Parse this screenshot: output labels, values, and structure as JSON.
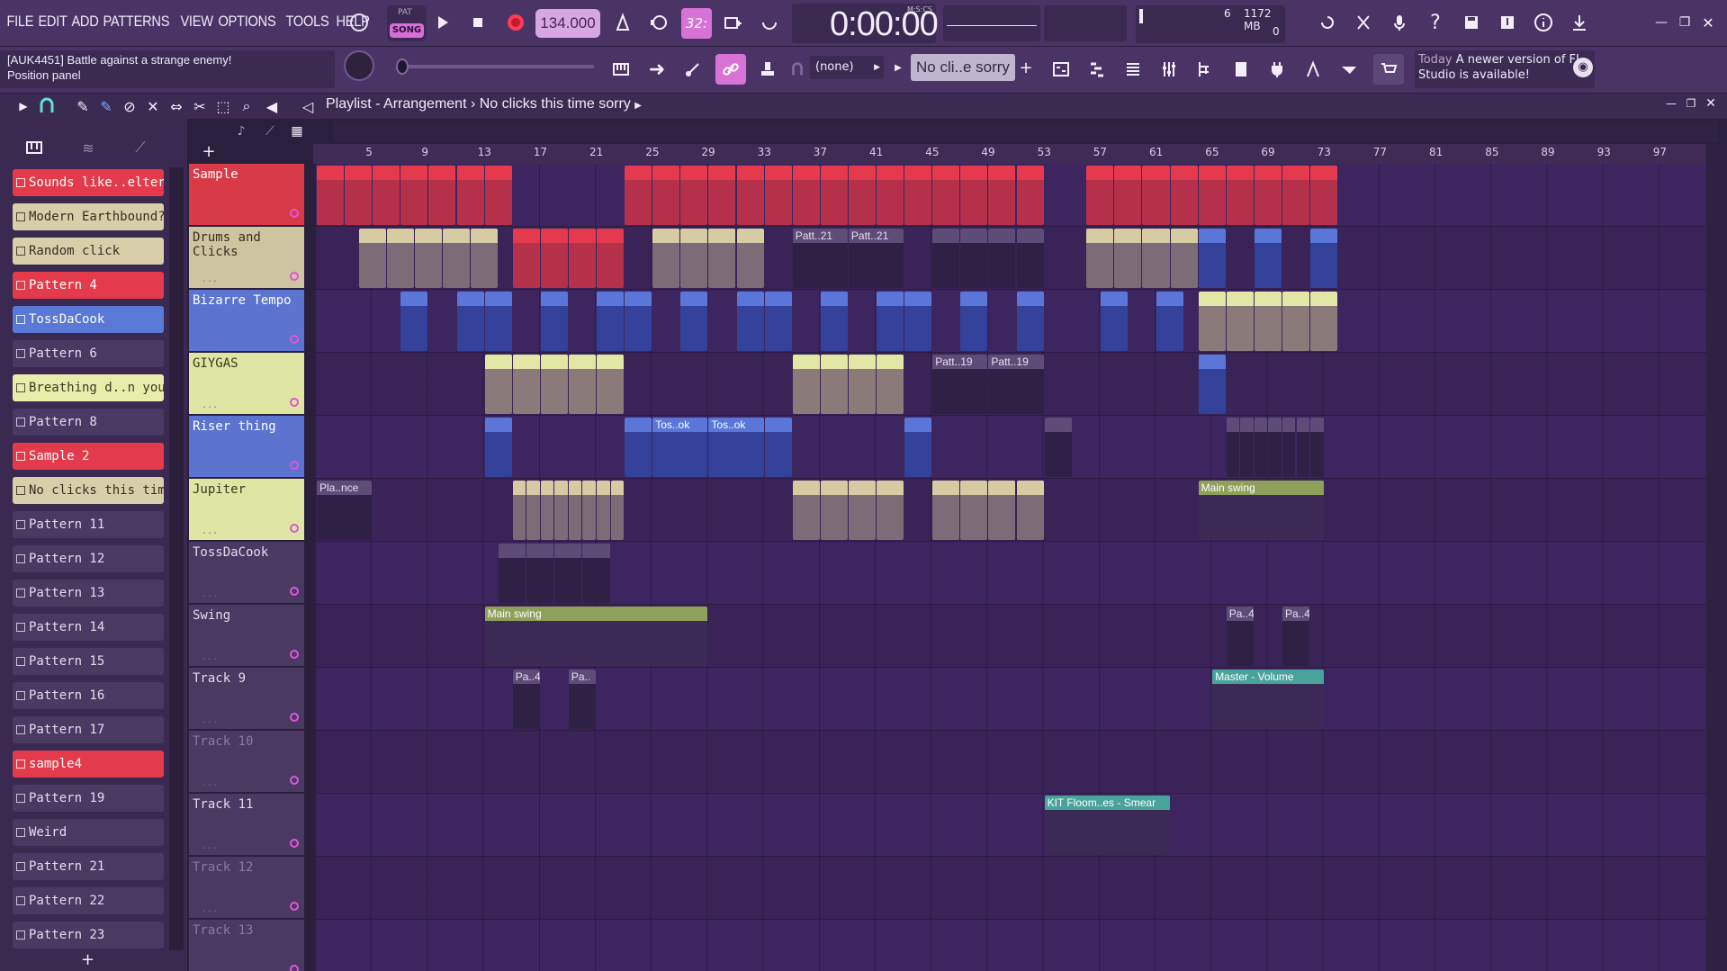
{
  "menu": [
    "FILE",
    "EDIT",
    "ADD",
    "PATTERNS",
    "VIEW",
    "OPTIONS",
    "TOOLS",
    "HELP"
  ],
  "transport": {
    "pat_label": "PAT",
    "song_label": "SONG",
    "tempo": "134.000",
    "time": "0:00:00",
    "time_unit": "M:S:CS",
    "snap": "32:"
  },
  "cpu": {
    "voices": "6",
    "memory": "1172 MB",
    "zero": "0"
  },
  "hint": {
    "line1": "[AUK4451] Battle against a strange enemy!",
    "line2": "Position panel"
  },
  "toolbar2": {
    "pattern_select": "(none)",
    "clip_select": "No cli..e sorry"
  },
  "news": {
    "today": "Today",
    "text": "A newer version of FL Studio is available!"
  },
  "playlist": {
    "title": "Playlist - Arrangement",
    "breadcrumb_sep": "›",
    "current": "No clicks this time sorry"
  },
  "ruler_ticks": [
    "5",
    "9",
    "13",
    "17",
    "21",
    "25",
    "29",
    "33",
    "37",
    "41",
    "45",
    "49",
    "53",
    "57",
    "61",
    "65",
    "69",
    "73",
    "77",
    "81",
    "85",
    "89",
    "93",
    "97"
  ],
  "patterns": [
    {
      "name": "Sounds like..elter kind of",
      "color": "#e33b4b",
      "text": "#ffffff"
    },
    {
      "name": "Modern Earthbound?",
      "color": "#d8cfaa",
      "text": "#3a2d20"
    },
    {
      "name": "Random click",
      "color": "#d8cfaa",
      "text": "#3a2d20"
    },
    {
      "name": "Pattern 4",
      "color": "#e33b4b",
      "text": "#ffffff"
    },
    {
      "name": "TossDaCook",
      "color": "#5a78d6",
      "text": "#ffffff"
    },
    {
      "name": "Pattern 6",
      "color": "#4a3963",
      "text": "#e4dbef"
    },
    {
      "name": "Breathing d..n your neck",
      "color": "#e8edab",
      "text": "#3a3a20"
    },
    {
      "name": "Pattern 8",
      "color": "#4a3963",
      "text": "#e4dbef"
    },
    {
      "name": "Sample 2",
      "color": "#e33b4b",
      "text": "#ffffff"
    },
    {
      "name": "No clicks this time sorry",
      "color": "#d8cfaa",
      "text": "#3a2d20"
    },
    {
      "name": "Pattern 11",
      "color": "#4a3963",
      "text": "#e4dbef"
    },
    {
      "name": "Pattern 12",
      "color": "#4a3963",
      "text": "#e4dbef"
    },
    {
      "name": "Pattern 13",
      "color": "#4a3963",
      "text": "#e4dbef"
    },
    {
      "name": "Pattern 14",
      "color": "#4a3963",
      "text": "#e4dbef"
    },
    {
      "name": "Pattern 15",
      "color": "#4a3963",
      "text": "#e4dbef"
    },
    {
      "name": "Pattern 16",
      "color": "#4a3963",
      "text": "#e4dbef"
    },
    {
      "name": "Pattern 17",
      "color": "#4a3963",
      "text": "#e4dbef"
    },
    {
      "name": "sample4",
      "color": "#e33b4b",
      "text": "#ffffff"
    },
    {
      "name": "Pattern 19",
      "color": "#4a3963",
      "text": "#e4dbef"
    },
    {
      "name": "Weird",
      "color": "#4a3963",
      "text": "#e4dbef"
    },
    {
      "name": "Pattern 21",
      "color": "#4a3963",
      "text": "#e4dbef"
    },
    {
      "name": "Pattern 22",
      "color": "#4a3963",
      "text": "#e4dbef"
    },
    {
      "name": "Pattern 23",
      "color": "#4a3963",
      "text": "#e4dbef"
    }
  ],
  "tracks": [
    {
      "name": "Sample",
      "color": "#d93a48",
      "text": "#ffffff"
    },
    {
      "name": "Drums and Clicks",
      "color": "#cfc4a0",
      "text": "#3a2d20"
    },
    {
      "name": "Bizarre Tempo",
      "color": "#5c73d0",
      "text": "#ffffff"
    },
    {
      "name": "GIYGAS",
      "color": "#dfe5a2",
      "text": "#3a3a20"
    },
    {
      "name": "Riser thing",
      "color": "#5c73d0",
      "text": "#ffffff"
    },
    {
      "name": "Jupiter",
      "color": "#dfe5a2",
      "text": "#3a3a20"
    },
    {
      "name": "TossDaCook",
      "color": "#4a3963",
      "text": "#e4dbef"
    },
    {
      "name": "Swing",
      "color": "#4a3963",
      "text": "#e4dbef"
    },
    {
      "name": "Track 9",
      "color": "#4a3963",
      "text": "#e4dbef"
    },
    {
      "name": "Track 10",
      "color": "#4a3963",
      "text": "#8a7aa0"
    },
    {
      "name": "Track 11",
      "color": "#4a3963",
      "text": "#e4dbef"
    },
    {
      "name": "Track 12",
      "color": "#4a3963",
      "text": "#8a7aa0"
    },
    {
      "name": "Track 13",
      "color": "#4a3963",
      "text": "#8a7aa0"
    }
  ],
  "clips": [
    {
      "track": 1,
      "label": "Patt..21"
    },
    {
      "track": 1,
      "label": "Patt..21"
    },
    {
      "track": 3,
      "label": "Patt..19"
    },
    {
      "track": 3,
      "label": "Patt..19"
    },
    {
      "track": 4,
      "label": "Tos..ok"
    },
    {
      "track": 4,
      "label": "Tos..ok"
    },
    {
      "track": 5,
      "label": "Pla..nce"
    },
    {
      "track": 6,
      "label": "Main swing"
    },
    {
      "track": 7,
      "label": "Main swing"
    },
    {
      "track": 7,
      "label": "Pa..4"
    },
    {
      "track": 7,
      "label": "Pa..4"
    },
    {
      "track": 8,
      "label": "Pa..4"
    },
    {
      "track": 8,
      "label": "Pa.."
    },
    {
      "track": 8,
      "label": "Master - Volume"
    },
    {
      "track": 10,
      "label": "KIT Floom..es - Smear"
    }
  ]
}
